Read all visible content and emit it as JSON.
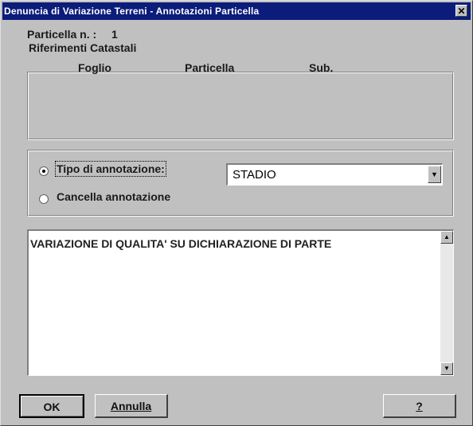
{
  "window": {
    "title": "Denuncia di Variazione Terreni - Annotazioni Particella",
    "close_glyph": "✕"
  },
  "particella": {
    "label": "Particella n. :",
    "value": "1"
  },
  "riferimenti": {
    "legend": "Riferimenti Catastali",
    "columns": [
      "Foglio",
      "Particella",
      "Sub."
    ]
  },
  "annotazione": {
    "option_tipo": "Tipo di annotazione:",
    "option_cancella": "Cancella annotazione",
    "selected_option": "tipo",
    "tipo_value": "STADIO"
  },
  "memo": {
    "text": "VARIAZIONE DI QUALITA' SU DICHIARAZIONE DI PARTE"
  },
  "buttons": {
    "ok": "OK",
    "annulla": "Annulla",
    "help": "?"
  },
  "colors": {
    "titlebar": "#0b1c7a",
    "face": "#c0c0c0"
  }
}
